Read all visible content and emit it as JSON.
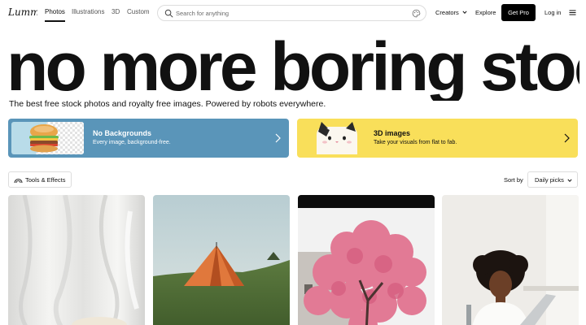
{
  "nav": {
    "logo_text": "Lummi",
    "tabs": [
      {
        "label": "Photos",
        "active": true
      },
      {
        "label": "Illustrations",
        "active": false
      },
      {
        "label": "3D",
        "active": false
      },
      {
        "label": "Custom",
        "active": false
      }
    ],
    "search": {
      "placeholder": "Search for anything"
    },
    "creators_label": "Creators",
    "explore_label": "Explore",
    "getpro_label": "Get Pro",
    "login_label": "Log in"
  },
  "hero": {
    "title": "no more boring stock",
    "subtitle": "The best free stock photos and royalty free images. Powered by robots everywhere."
  },
  "promos": [
    {
      "title": "No Backgrounds",
      "subtitle": "Every image, background-free.",
      "color": "#5a95b9"
    },
    {
      "title": "3D images",
      "subtitle": "Take your visuals from flat to fab.",
      "color": "#f9df5a"
    }
  ],
  "toolbar": {
    "tools_label": "Tools & Effects",
    "sort_label": "Sort by",
    "sort_value": "Daily picks"
  },
  "photos": [
    {
      "subject": "white-fabric"
    },
    {
      "subject": "orange-tent"
    },
    {
      "subject": "pink-tree"
    },
    {
      "subject": "woman-laptop"
    }
  ],
  "icons": {
    "search": "search-icon",
    "visual_search": "palette-icon",
    "chevron": "chevron-down-icon",
    "menu": "menu-icon",
    "arrow": "chevron-right-icon",
    "tools": "rainbow-icon"
  }
}
